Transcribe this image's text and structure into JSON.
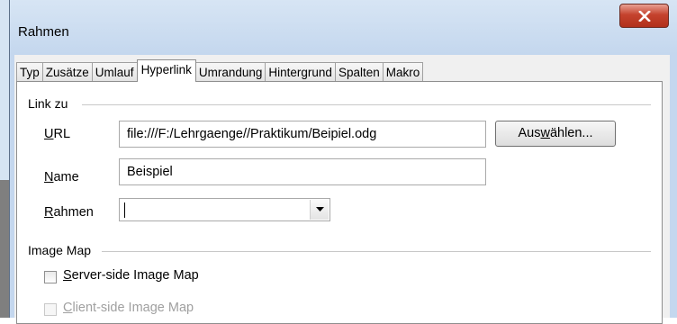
{
  "window": {
    "title": "Rahmen",
    "close_icon": "close-icon"
  },
  "tabs": [
    {
      "label": "Typ",
      "active": false
    },
    {
      "label": "Zusätze",
      "active": false
    },
    {
      "label": "Umlauf",
      "active": false
    },
    {
      "label": "Hyperlink",
      "active": true
    },
    {
      "label": "Umrandung",
      "active": false
    },
    {
      "label": "Hintergrund",
      "active": false
    },
    {
      "label": "Spalten",
      "active": false
    },
    {
      "label": "Makro",
      "active": false
    }
  ],
  "link_section": {
    "title": "Link zu",
    "url_label_mnemonic": "U",
    "url_label_rest": "RL",
    "url_value": "file:///F:/Lehrgaenge//Praktikum/Beipiel.odg",
    "browse_pre": "Aus",
    "browse_mnemonic": "w",
    "browse_post": "ählen...",
    "name_label_mnemonic": "N",
    "name_label_rest": "ame",
    "name_value": "Beispiel",
    "frame_label_mnemonic": "R",
    "frame_label_rest": "ahmen",
    "frame_value": ""
  },
  "image_map_section": {
    "title": "Image Map",
    "server_mnemonic": "S",
    "server_rest": "erver-side Image Map",
    "server_checked": false,
    "client_mnemonic": "C",
    "client_rest": "lient-side Image Map",
    "client_checked": false,
    "client_disabled": true
  }
}
